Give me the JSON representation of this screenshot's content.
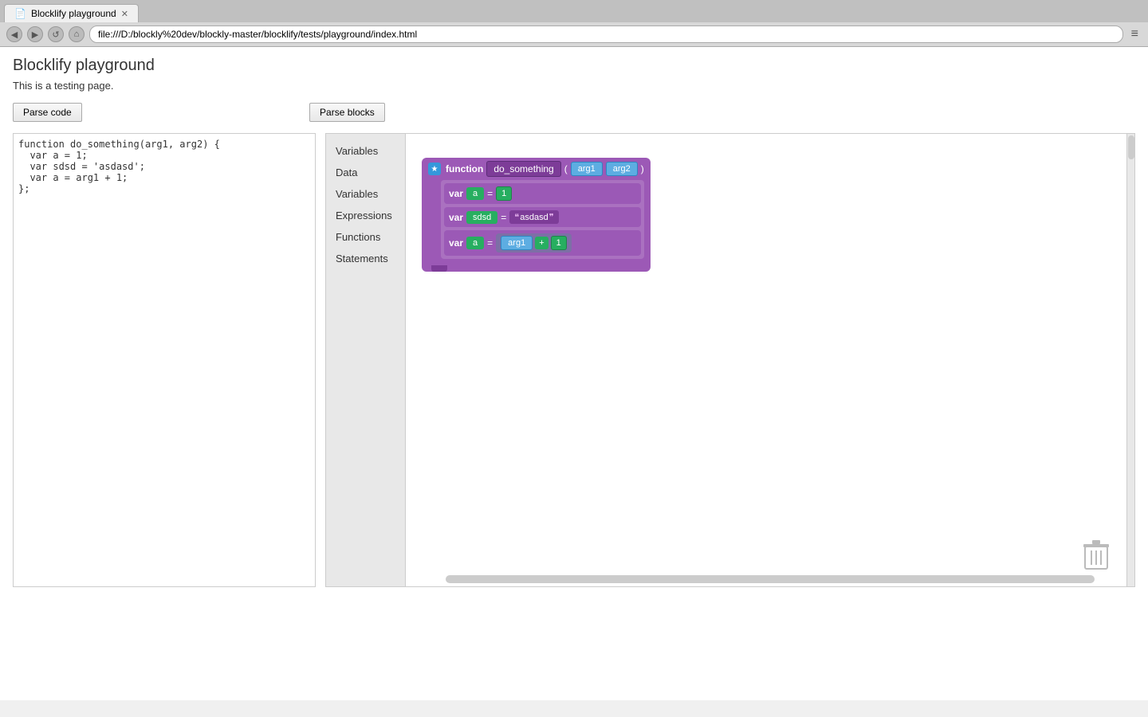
{
  "browser": {
    "tab_title": "Blocklify playground",
    "url": "file:///D:/blockly%20dev/blockly-master/blocklify/tests/playground/index.html",
    "nav_back": "◀",
    "nav_fwd": "▶",
    "nav_reload": "↺",
    "nav_home": "⌂",
    "menu": "≡"
  },
  "page": {
    "title": "Blocklify playground",
    "subtitle": "This is a testing page."
  },
  "buttons": {
    "parse_code": "Parse code",
    "parse_blocks": "Parse blocks"
  },
  "code_editor": {
    "content": "function do_something(arg1, arg2) {\n  var a = 1;\n  var sdsd = 'asdasd';\n  var a = arg1 + 1;\n};"
  },
  "toolbox": {
    "items": [
      "Variables",
      "Data",
      "Variables",
      "Expressions",
      "Functions",
      "Statements"
    ]
  },
  "blocks": {
    "function_name": "do_something",
    "arg1": "arg1",
    "arg2": "arg2",
    "var1": {
      "name": "a",
      "value": "1"
    },
    "var2": {
      "name": "sdsd",
      "string_value": "asdasd"
    },
    "var3": {
      "name": "a",
      "ref": "arg1",
      "op": "+",
      "num": "1"
    }
  },
  "star_symbol": "★"
}
